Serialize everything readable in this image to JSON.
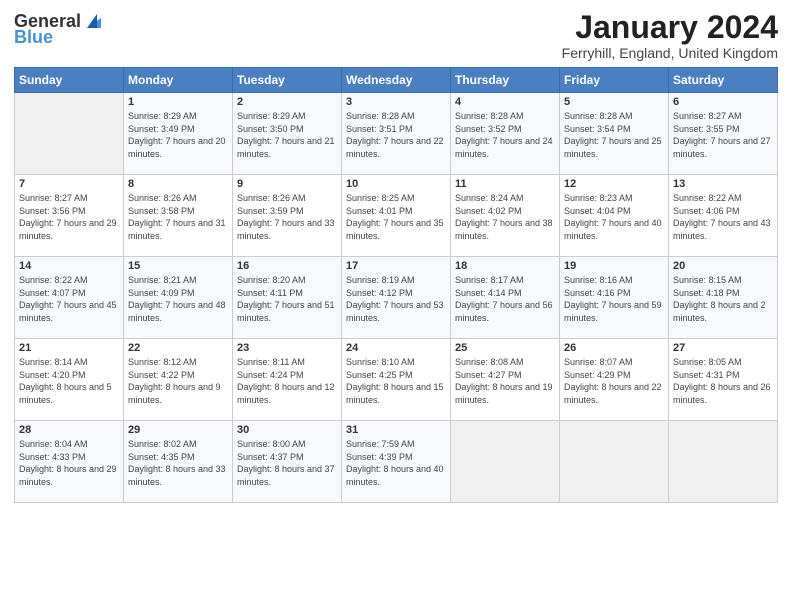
{
  "header": {
    "logo_general": "General",
    "logo_blue": "Blue",
    "month_title": "January 2024",
    "location": "Ferryhill, England, United Kingdom"
  },
  "days_of_week": [
    "Sunday",
    "Monday",
    "Tuesday",
    "Wednesday",
    "Thursday",
    "Friday",
    "Saturday"
  ],
  "weeks": [
    [
      {
        "day": "",
        "sunrise": "",
        "sunset": "",
        "daylight": ""
      },
      {
        "day": "1",
        "sunrise": "Sunrise: 8:29 AM",
        "sunset": "Sunset: 3:49 PM",
        "daylight": "Daylight: 7 hours and 20 minutes."
      },
      {
        "day": "2",
        "sunrise": "Sunrise: 8:29 AM",
        "sunset": "Sunset: 3:50 PM",
        "daylight": "Daylight: 7 hours and 21 minutes."
      },
      {
        "day": "3",
        "sunrise": "Sunrise: 8:28 AM",
        "sunset": "Sunset: 3:51 PM",
        "daylight": "Daylight: 7 hours and 22 minutes."
      },
      {
        "day": "4",
        "sunrise": "Sunrise: 8:28 AM",
        "sunset": "Sunset: 3:52 PM",
        "daylight": "Daylight: 7 hours and 24 minutes."
      },
      {
        "day": "5",
        "sunrise": "Sunrise: 8:28 AM",
        "sunset": "Sunset: 3:54 PM",
        "daylight": "Daylight: 7 hours and 25 minutes."
      },
      {
        "day": "6",
        "sunrise": "Sunrise: 8:27 AM",
        "sunset": "Sunset: 3:55 PM",
        "daylight": "Daylight: 7 hours and 27 minutes."
      }
    ],
    [
      {
        "day": "7",
        "sunrise": "Sunrise: 8:27 AM",
        "sunset": "Sunset: 3:56 PM",
        "daylight": "Daylight: 7 hours and 29 minutes."
      },
      {
        "day": "8",
        "sunrise": "Sunrise: 8:26 AM",
        "sunset": "Sunset: 3:58 PM",
        "daylight": "Daylight: 7 hours and 31 minutes."
      },
      {
        "day": "9",
        "sunrise": "Sunrise: 8:26 AM",
        "sunset": "Sunset: 3:59 PM",
        "daylight": "Daylight: 7 hours and 33 minutes."
      },
      {
        "day": "10",
        "sunrise": "Sunrise: 8:25 AM",
        "sunset": "Sunset: 4:01 PM",
        "daylight": "Daylight: 7 hours and 35 minutes."
      },
      {
        "day": "11",
        "sunrise": "Sunrise: 8:24 AM",
        "sunset": "Sunset: 4:02 PM",
        "daylight": "Daylight: 7 hours and 38 minutes."
      },
      {
        "day": "12",
        "sunrise": "Sunrise: 8:23 AM",
        "sunset": "Sunset: 4:04 PM",
        "daylight": "Daylight: 7 hours and 40 minutes."
      },
      {
        "day": "13",
        "sunrise": "Sunrise: 8:22 AM",
        "sunset": "Sunset: 4:06 PM",
        "daylight": "Daylight: 7 hours and 43 minutes."
      }
    ],
    [
      {
        "day": "14",
        "sunrise": "Sunrise: 8:22 AM",
        "sunset": "Sunset: 4:07 PM",
        "daylight": "Daylight: 7 hours and 45 minutes."
      },
      {
        "day": "15",
        "sunrise": "Sunrise: 8:21 AM",
        "sunset": "Sunset: 4:09 PM",
        "daylight": "Daylight: 7 hours and 48 minutes."
      },
      {
        "day": "16",
        "sunrise": "Sunrise: 8:20 AM",
        "sunset": "Sunset: 4:11 PM",
        "daylight": "Daylight: 7 hours and 51 minutes."
      },
      {
        "day": "17",
        "sunrise": "Sunrise: 8:19 AM",
        "sunset": "Sunset: 4:12 PM",
        "daylight": "Daylight: 7 hours and 53 minutes."
      },
      {
        "day": "18",
        "sunrise": "Sunrise: 8:17 AM",
        "sunset": "Sunset: 4:14 PM",
        "daylight": "Daylight: 7 hours and 56 minutes."
      },
      {
        "day": "19",
        "sunrise": "Sunrise: 8:16 AM",
        "sunset": "Sunset: 4:16 PM",
        "daylight": "Daylight: 7 hours and 59 minutes."
      },
      {
        "day": "20",
        "sunrise": "Sunrise: 8:15 AM",
        "sunset": "Sunset: 4:18 PM",
        "daylight": "Daylight: 8 hours and 2 minutes."
      }
    ],
    [
      {
        "day": "21",
        "sunrise": "Sunrise: 8:14 AM",
        "sunset": "Sunset: 4:20 PM",
        "daylight": "Daylight: 8 hours and 5 minutes."
      },
      {
        "day": "22",
        "sunrise": "Sunrise: 8:12 AM",
        "sunset": "Sunset: 4:22 PM",
        "daylight": "Daylight: 8 hours and 9 minutes."
      },
      {
        "day": "23",
        "sunrise": "Sunrise: 8:11 AM",
        "sunset": "Sunset: 4:24 PM",
        "daylight": "Daylight: 8 hours and 12 minutes."
      },
      {
        "day": "24",
        "sunrise": "Sunrise: 8:10 AM",
        "sunset": "Sunset: 4:25 PM",
        "daylight": "Daylight: 8 hours and 15 minutes."
      },
      {
        "day": "25",
        "sunrise": "Sunrise: 8:08 AM",
        "sunset": "Sunset: 4:27 PM",
        "daylight": "Daylight: 8 hours and 19 minutes."
      },
      {
        "day": "26",
        "sunrise": "Sunrise: 8:07 AM",
        "sunset": "Sunset: 4:29 PM",
        "daylight": "Daylight: 8 hours and 22 minutes."
      },
      {
        "day": "27",
        "sunrise": "Sunrise: 8:05 AM",
        "sunset": "Sunset: 4:31 PM",
        "daylight": "Daylight: 8 hours and 26 minutes."
      }
    ],
    [
      {
        "day": "28",
        "sunrise": "Sunrise: 8:04 AM",
        "sunset": "Sunset: 4:33 PM",
        "daylight": "Daylight: 8 hours and 29 minutes."
      },
      {
        "day": "29",
        "sunrise": "Sunrise: 8:02 AM",
        "sunset": "Sunset: 4:35 PM",
        "daylight": "Daylight: 8 hours and 33 minutes."
      },
      {
        "day": "30",
        "sunrise": "Sunrise: 8:00 AM",
        "sunset": "Sunset: 4:37 PM",
        "daylight": "Daylight: 8 hours and 37 minutes."
      },
      {
        "day": "31",
        "sunrise": "Sunrise: 7:59 AM",
        "sunset": "Sunset: 4:39 PM",
        "daylight": "Daylight: 8 hours and 40 minutes."
      },
      {
        "day": "",
        "sunrise": "",
        "sunset": "",
        "daylight": ""
      },
      {
        "day": "",
        "sunrise": "",
        "sunset": "",
        "daylight": ""
      },
      {
        "day": "",
        "sunrise": "",
        "sunset": "",
        "daylight": ""
      }
    ]
  ]
}
